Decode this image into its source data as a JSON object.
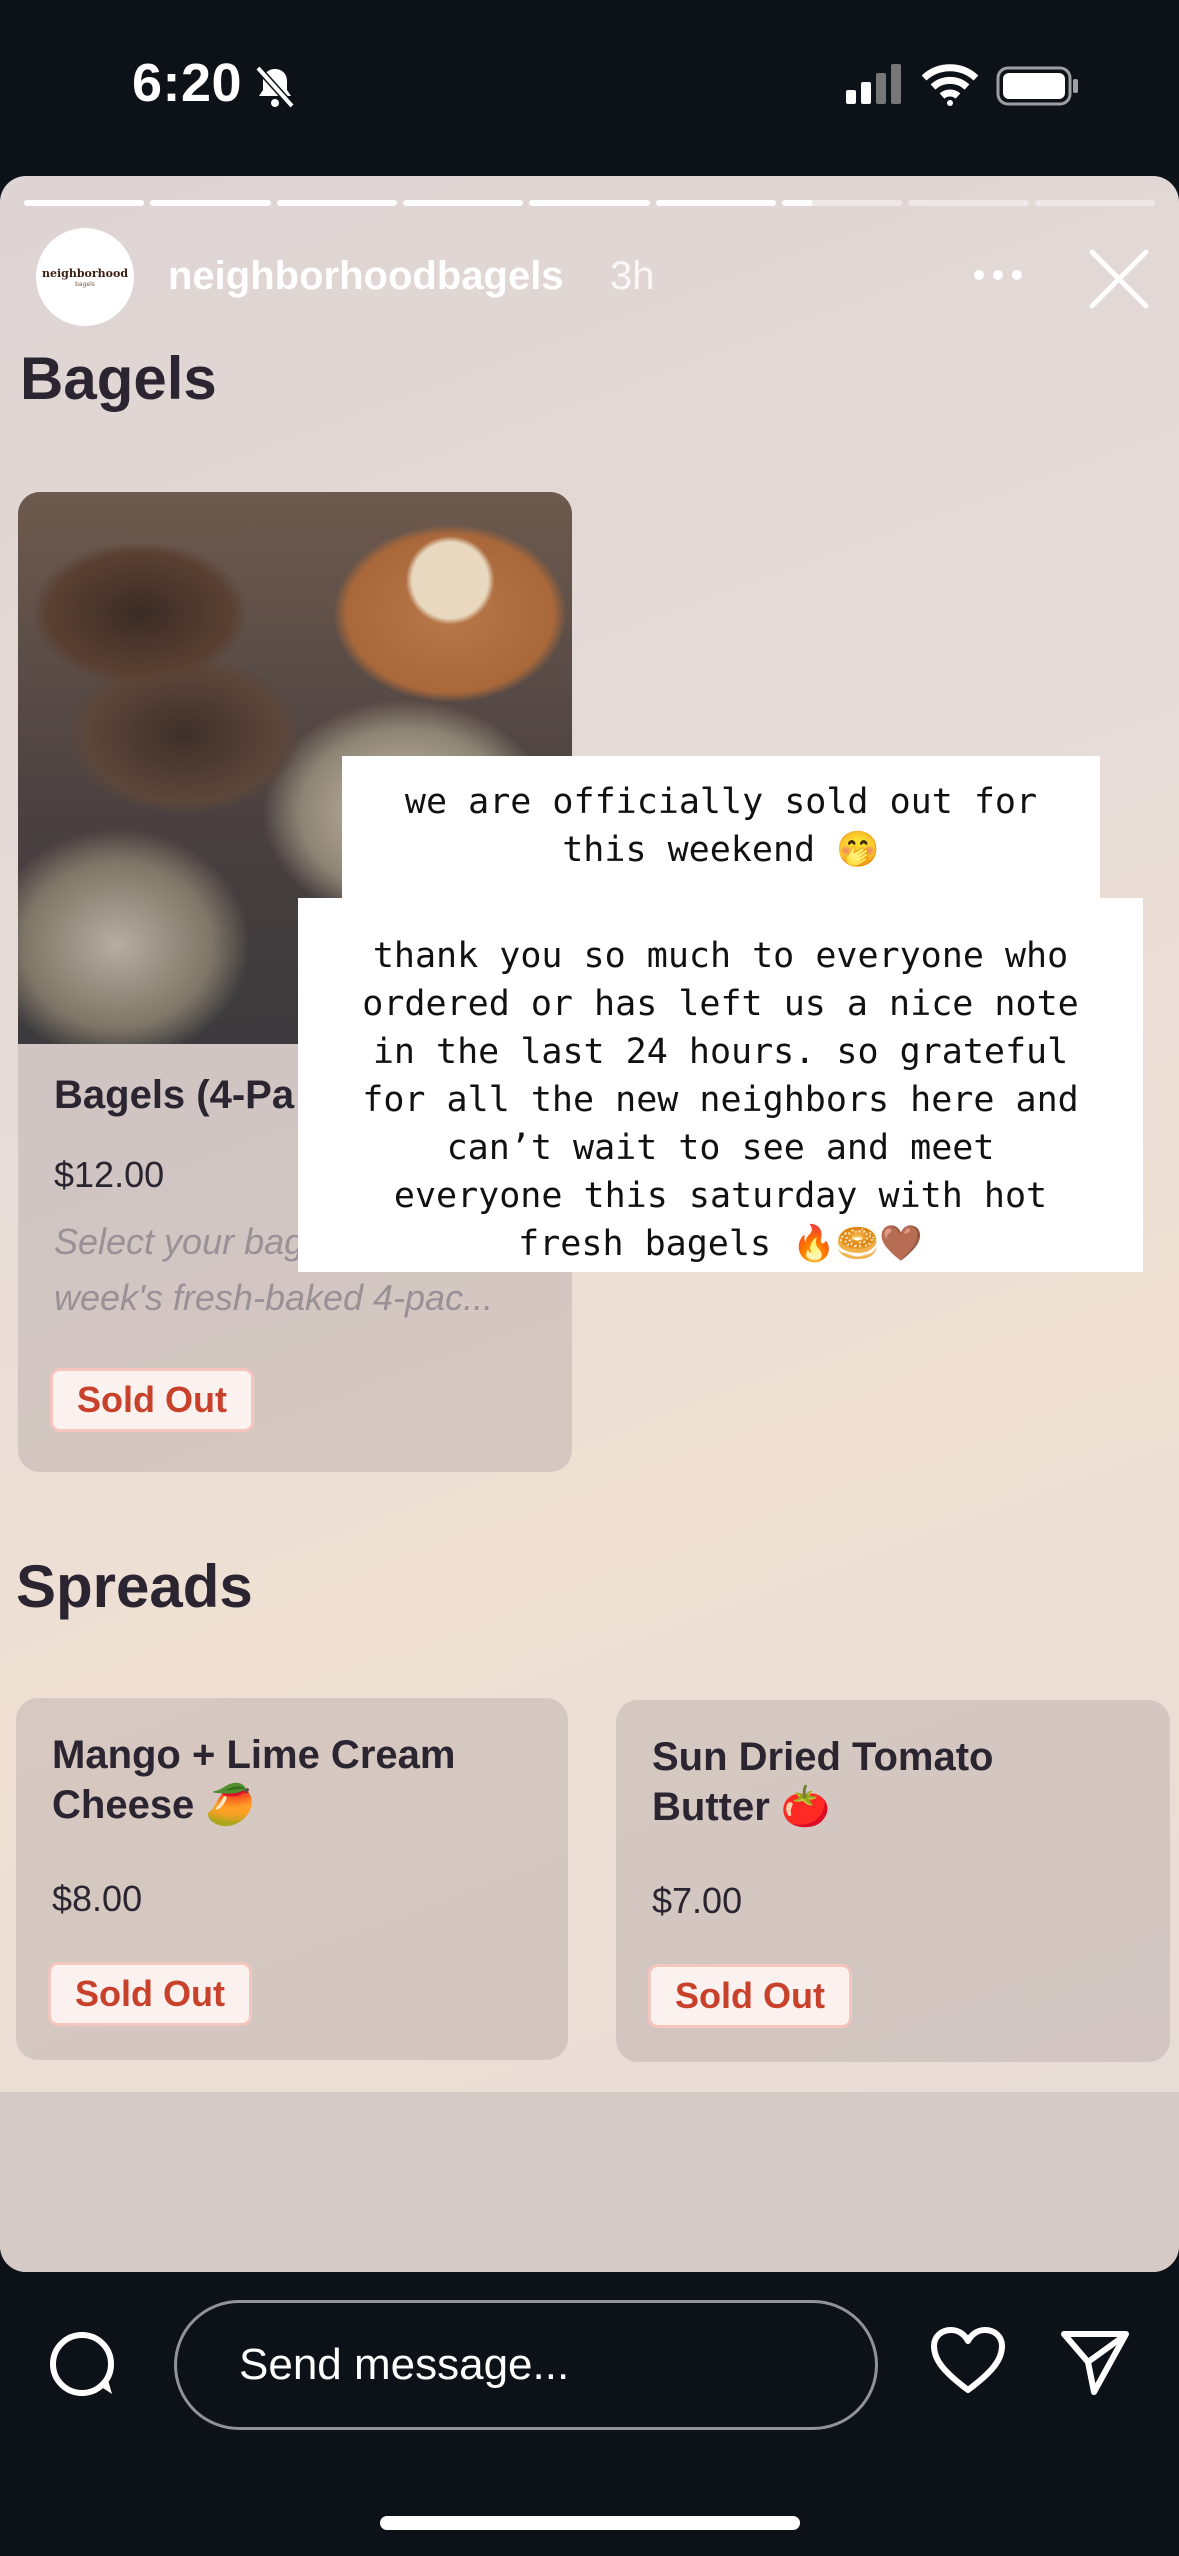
{
  "status": {
    "time": "6:20"
  },
  "story": {
    "username": "neighborhoodbagels",
    "time_ago": "3h",
    "avatar_text_1": "neighborhood",
    "avatar_text_2": "bagels",
    "progress_segments": [
      1,
      1,
      1,
      1,
      1,
      1,
      0.25,
      0,
      0
    ],
    "menu": {
      "section_bagels": "Bagels",
      "section_spreads": "Spreads",
      "items": [
        {
          "name": "Bagels (4-Pa",
          "price": "$12.00",
          "description_line1": "Select your bagels for this",
          "description_line2": "week's fresh-baked 4-pac...",
          "status": "Sold Out"
        },
        {
          "name_line1": "Mango + Lime Cream",
          "name_line2": "Cheese 🥭",
          "price": "$8.00",
          "status": "Sold Out"
        },
        {
          "name_line1": "Sun Dried Tomato",
          "name_line2": "Butter 🍅",
          "price": "$7.00",
          "status": "Sold Out"
        }
      ]
    },
    "notes": {
      "note1": "we are officially sold out for\nthis weekend 🤭",
      "note2": "thank you so much to everyone who\nordered or has left us a nice note\nin the last 24 hours. so grateful\nfor all the new neighbors here and\ncan’t wait to see and meet\neveryone this saturday with hot\nfresh bagels 🔥🥯🤎"
    }
  },
  "bottom_bar": {
    "message_placeholder": "Send message..."
  },
  "icons": [
    "bell-off-icon",
    "signal-icon",
    "wifi-icon",
    "battery-icon",
    "more-icon",
    "close-icon",
    "camera-icon",
    "heart-icon",
    "send-icon"
  ]
}
